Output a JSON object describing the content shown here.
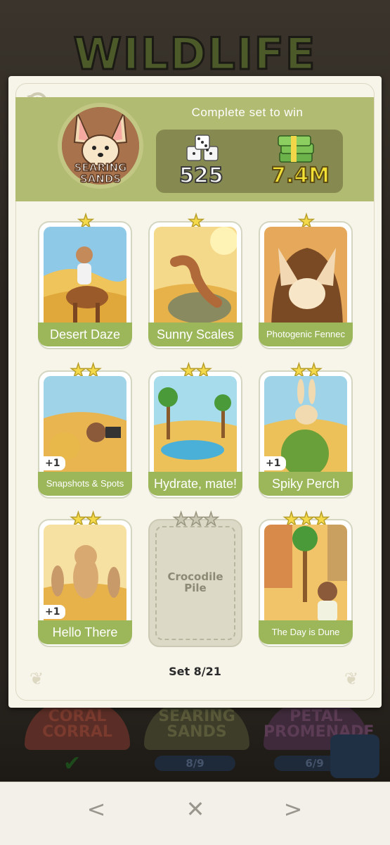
{
  "background": {
    "title": "WILDLIFE",
    "badges": [
      {
        "label": "CORAL CORRAL"
      },
      {
        "label": "SEARING SANDS",
        "progress": "8/9"
      },
      {
        "label": "PETAL PROMENADE",
        "progress": "6/9"
      }
    ]
  },
  "set": {
    "badge_label_line1": "SEARING",
    "badge_label_line2": "SANDS",
    "header_title": "Complete set to win",
    "reward_dice": "525",
    "reward_cash": "7.4M",
    "progress": "Set 8/21"
  },
  "cards": [
    {
      "name": "Desert Daze",
      "stars": 1,
      "collected": true
    },
    {
      "name": "Sunny Scales",
      "stars": 1,
      "collected": true
    },
    {
      "name": "Photogenic Fennec",
      "stars": 1,
      "collected": true
    },
    {
      "name": "Snapshots & Spots",
      "stars": 2,
      "collected": true,
      "extra": "+1"
    },
    {
      "name": "Hydrate, mate!",
      "stars": 2,
      "collected": true
    },
    {
      "name": "Spiky Perch",
      "stars": 2,
      "collected": true,
      "extra": "+1"
    },
    {
      "name": "Hello There",
      "stars": 2,
      "collected": true,
      "extra": "+1"
    },
    {
      "name": "Crocodile Pile",
      "stars": 3,
      "collected": false
    },
    {
      "name": "The Day is Dune",
      "stars": 3,
      "collected": true
    }
  ],
  "nav": {
    "prev": "<",
    "close": "✕",
    "next": ">"
  }
}
